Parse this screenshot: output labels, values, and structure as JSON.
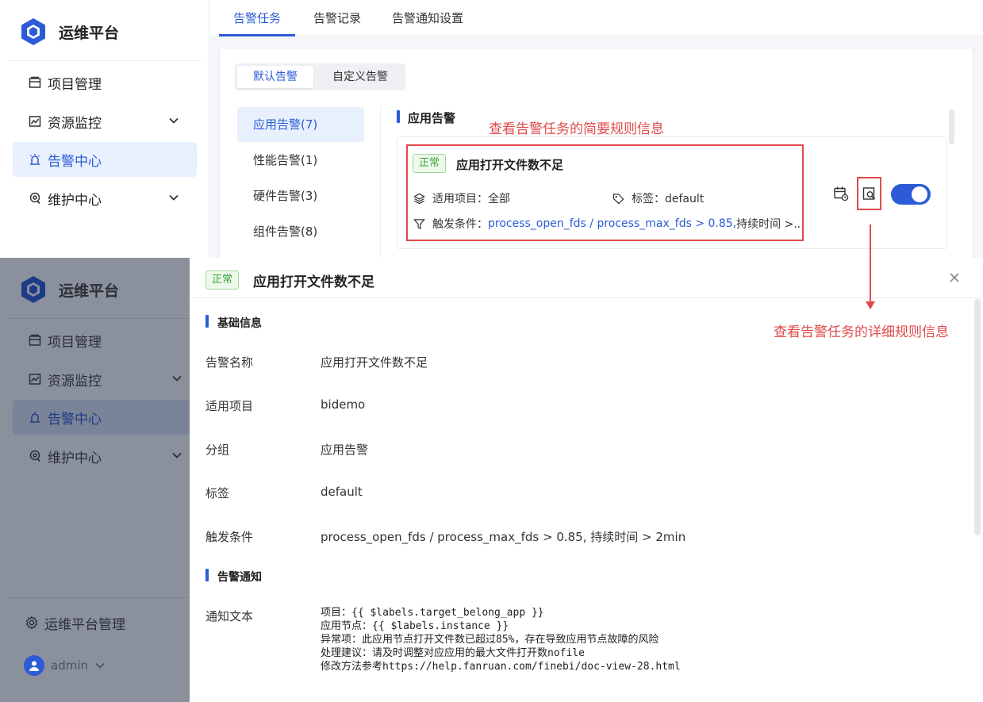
{
  "app": {
    "title": "运维平台"
  },
  "sidebar": {
    "items": [
      {
        "label": "项目管理",
        "icon": "folder-icon"
      },
      {
        "label": "资源监控",
        "icon": "monitor-chart-icon"
      },
      {
        "label": "告警中心",
        "icon": "alarm-icon"
      },
      {
        "label": "维护中心",
        "icon": "maintenance-icon"
      }
    ],
    "platform_admin": "运维平台管理",
    "user": "admin"
  },
  "tabs": [
    "告警任务",
    "告警记录",
    "告警通知设置"
  ],
  "segment": {
    "default": "默认告警",
    "custom": "自定义告警"
  },
  "categories": [
    "应用告警(7)",
    "性能告警(1)",
    "硬件告警(3)",
    "组件告警(8)"
  ],
  "section_title": "应用告警",
  "alert_card": {
    "status": "正常",
    "name": "应用打开文件数不足",
    "project_label": "适用项目：全部",
    "tag_label": "标签：default",
    "trigger_label": "触发条件：",
    "trigger_value": "process_open_fds / process_max_fds > 0.85,",
    "trigger_suffix": " 持续时间 >..."
  },
  "annotations": {
    "brief": "查看告警任务的简要规则信息",
    "detail": "查看告警任务的详细规则信息"
  },
  "drawer": {
    "status": "正常",
    "title": "应用打开文件数不足",
    "basic_title": "基础信息",
    "fields": [
      {
        "label": "告警名称",
        "value": "应用打开文件数不足"
      },
      {
        "label": "适用项目",
        "value": "bidemo"
      },
      {
        "label": "分组",
        "value": "应用告警"
      },
      {
        "label": "标签",
        "value": "default"
      },
      {
        "label": "触发条件",
        "value": "process_open_fds / process_max_fds > 0.85, 持续时间 > 2min"
      }
    ],
    "notify_title": "告警通知",
    "notify_label": "通知文本",
    "notify_text": "项目：{{ $labels.target_belong_app }}\n应用节点：{{ $labels.instance }}\n异常项：此应用节点打开文件数已超过85%，存在导致应用节点故障的风险\n处理建议：请及时调整对应应用的最大文件打开数nofile\n修改方法参考https://help.fanruan.com/finebi/doc-view-28.html"
  },
  "colors": {
    "accent": "#2b5bd7",
    "annotation": "#e04a4a",
    "success": "#3aa43a"
  }
}
